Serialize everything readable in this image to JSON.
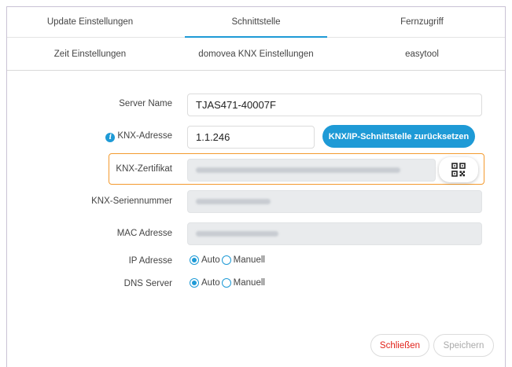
{
  "tabs_row1": [
    {
      "label": "Update Einstellungen",
      "active": false
    },
    {
      "label": "Schnittstelle",
      "active": true
    },
    {
      "label": "Fernzugriff",
      "active": false
    }
  ],
  "tabs_row2": [
    {
      "label": "Zeit Einstellungen"
    },
    {
      "label": "domovea KNX Einstellungen"
    },
    {
      "label": "easytool"
    }
  ],
  "form": {
    "server_name": {
      "label": "Server Name",
      "value": "TJAS471-40007F"
    },
    "knx_address": {
      "label": "KNX-Adresse",
      "value": "1.1.246",
      "info_icon": "info-icon"
    },
    "reset_button": "KNX/IP-Schnittstelle zurücksetzen",
    "knx_certificate": {
      "label": "KNX-Zertifikat",
      "value_obscured": true,
      "qr_icon": "qr-code-icon"
    },
    "knx_serial": {
      "label": "KNX-Seriennummer",
      "value_obscured": true
    },
    "mac_address": {
      "label": "MAC Adresse",
      "value_obscured": true
    },
    "ip_address": {
      "label": "IP Adresse",
      "options": [
        "Auto",
        "Manuell"
      ],
      "selected": "Auto"
    },
    "dns_server": {
      "label": "DNS Server",
      "options": [
        "Auto",
        "Manuell"
      ],
      "selected": "Auto"
    }
  },
  "footer": {
    "close_label": "Schließen",
    "save_label": "Speichern"
  },
  "colors": {
    "accent": "#1e9ad6",
    "highlight_border": "#f39a2e",
    "close_text": "#e2231a"
  }
}
